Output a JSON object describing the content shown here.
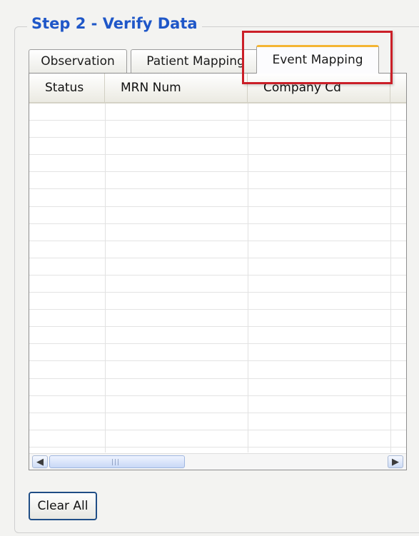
{
  "group": {
    "title": "Step 2 - Verify Data"
  },
  "tabs": [
    {
      "label": "Observation",
      "active": false
    },
    {
      "label": "Patient Mapping",
      "active": false
    },
    {
      "label": "Event Mapping",
      "active": true
    }
  ],
  "grid": {
    "columns": [
      "Status",
      "MRN Num",
      "Company Cd"
    ],
    "rows": []
  },
  "scrollbar": {
    "left_glyph": "◀",
    "right_glyph": "▶",
    "grip": "|||"
  },
  "actions": {
    "clear_all_label": "Clear All"
  },
  "colors": {
    "title": "#1f57c8",
    "highlight": "#cb1f28",
    "active_tab_accent": "#f4b533"
  }
}
